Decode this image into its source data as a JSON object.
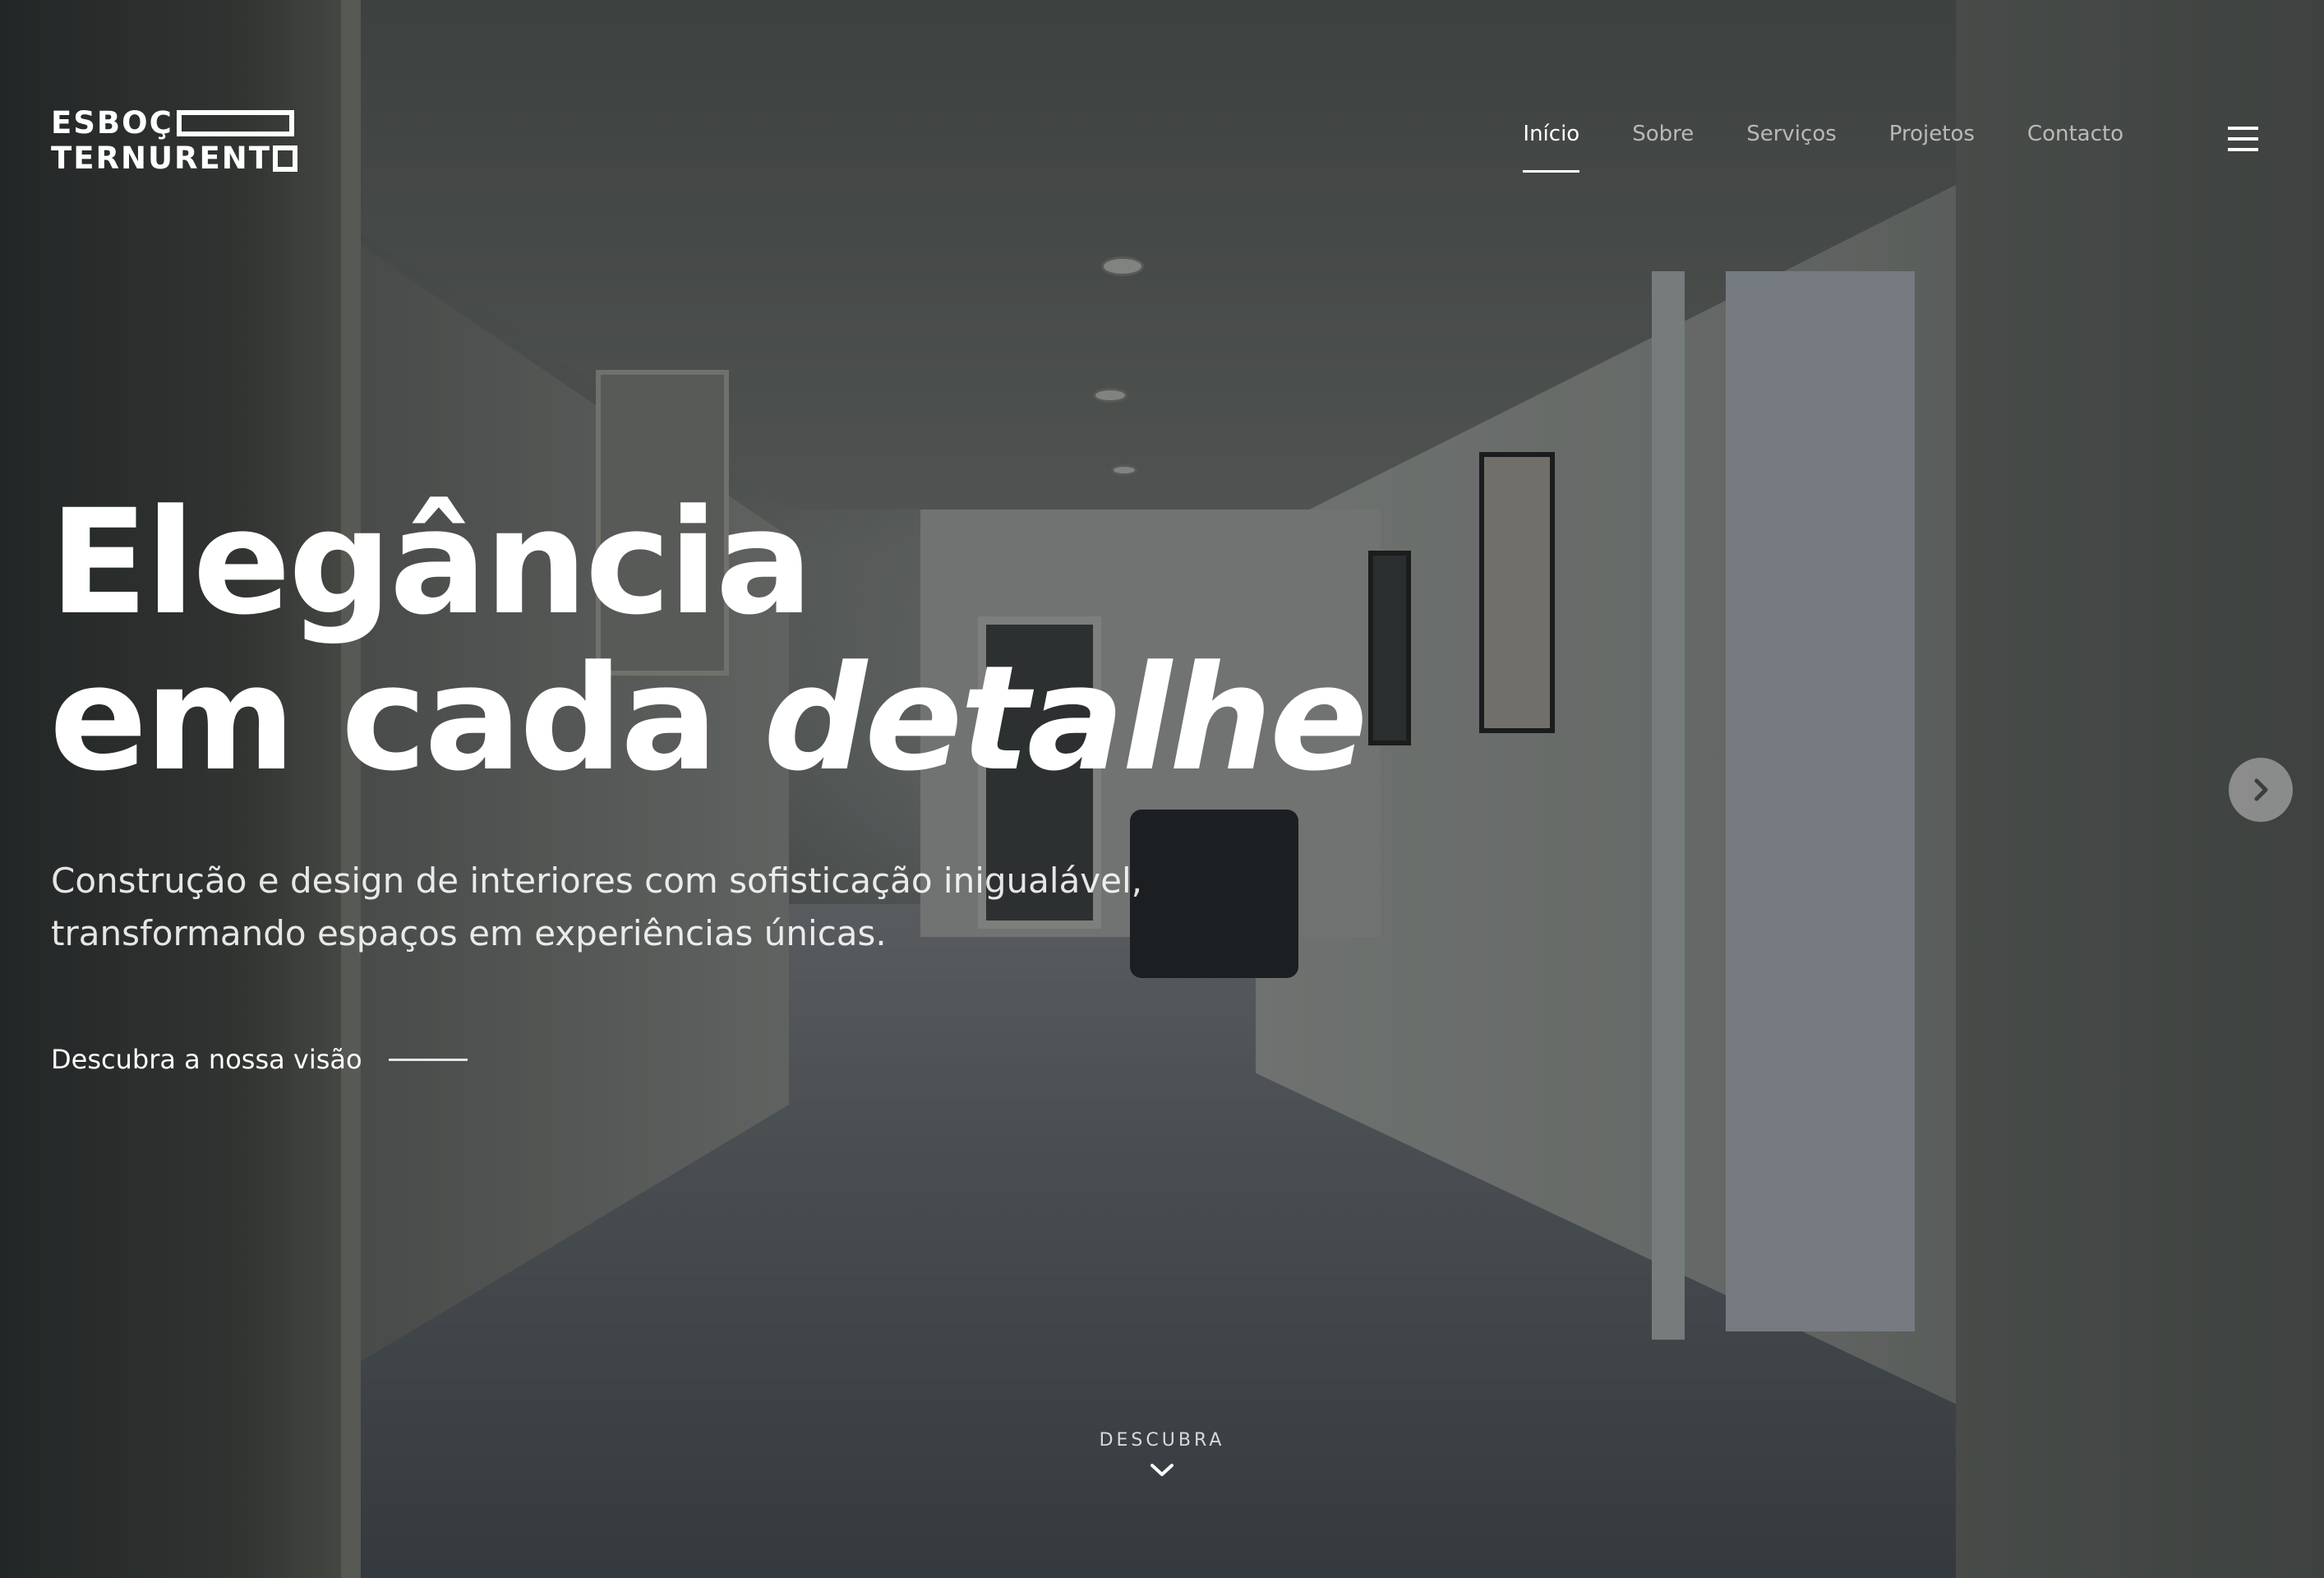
{
  "brand": {
    "line1": "ESBOÇ",
    "line2": "TERNURENT",
    "logo_text": "ESBOÇO TERNURENTO"
  },
  "nav": {
    "items": [
      {
        "label": "Início",
        "active": true
      },
      {
        "label": "Sobre",
        "active": false
      },
      {
        "label": "Serviços",
        "active": false
      },
      {
        "label": "Projetos",
        "active": false
      },
      {
        "label": "Contacto",
        "active": false
      }
    ],
    "menu_icon": "hamburger-icon"
  },
  "hero": {
    "title_line1": "Elegância",
    "title_line2_plain": "em cada ",
    "title_line2_emph": "detalhe",
    "subtitle_line1": "Construção e design de interiores com sofisticação inigualável,",
    "subtitle_line2": "transformando espaços em experiências únicas.",
    "cta_label": "Descubra a nossa visão",
    "next_icon": "chevron-right-icon"
  },
  "scroll": {
    "label": "DESCUBRA",
    "icon": "chevron-down-icon"
  },
  "colors": {
    "text": "#ffffff",
    "nav_inactive": "rgba(255,255,255,0.62)",
    "overlay": "rgba(25,28,30,0.45)",
    "next_button": "rgba(200,200,200,0.55)"
  }
}
